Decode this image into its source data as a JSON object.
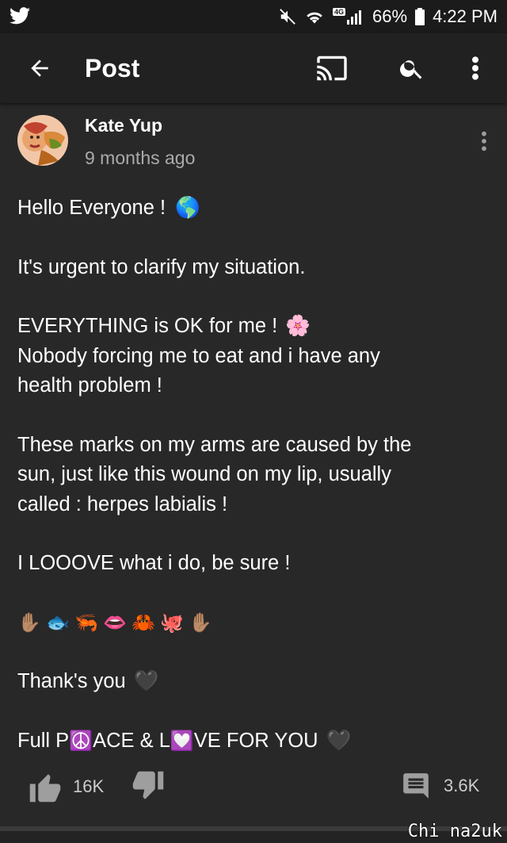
{
  "status_bar": {
    "network_badge": "4G",
    "battery_text": "66%",
    "time": "4:22 PM",
    "icons": [
      "twitter-icon",
      "mute-icon",
      "wifi-icon",
      "signal-icon",
      "battery-icon"
    ]
  },
  "app_bar": {
    "title": "Post",
    "icons": [
      "back-arrow-icon",
      "cast-icon",
      "search-icon",
      "more-vert-icon"
    ]
  },
  "post": {
    "author": "Kate Yup",
    "time_ago": "9 months ago",
    "lines": {
      "l1": "Hello Everyone !",
      "l2": "It's urgent to clarify my situation.",
      "l3": "EVERYTHING is OK for me !",
      "l4": "Nobody forcing me to eat and i have any",
      "l5": "health problem !",
      "l6": "These marks on my arms are caused by the",
      "l7": "sun, just like this wound on my lip, usually",
      "l8": "called : herpes labialis !",
      "l9": "I LOOOVE what i do, be sure !",
      "l10": "Thank's you",
      "l11a": "Full P",
      "l11b": "ACE & L",
      "l11c": "VE FOR YOU"
    },
    "emojis": {
      "globe": "🌎",
      "blossom": "🌸",
      "row": [
        "✋🏽",
        "🐟",
        "🦐",
        "👄",
        "🦀",
        "🐙",
        "✋🏽"
      ],
      "heart_black": "🖤",
      "peace": "☮️",
      "heart_red": "💟"
    }
  },
  "actions": {
    "likes": "16K",
    "comments": "3.6K"
  },
  "watermark": "Chi na2uk",
  "colors": {
    "background": "#282828",
    "app_bar": "#212121",
    "status_bar": "#1b1b1b",
    "secondary_text": "#aaaaaa"
  }
}
